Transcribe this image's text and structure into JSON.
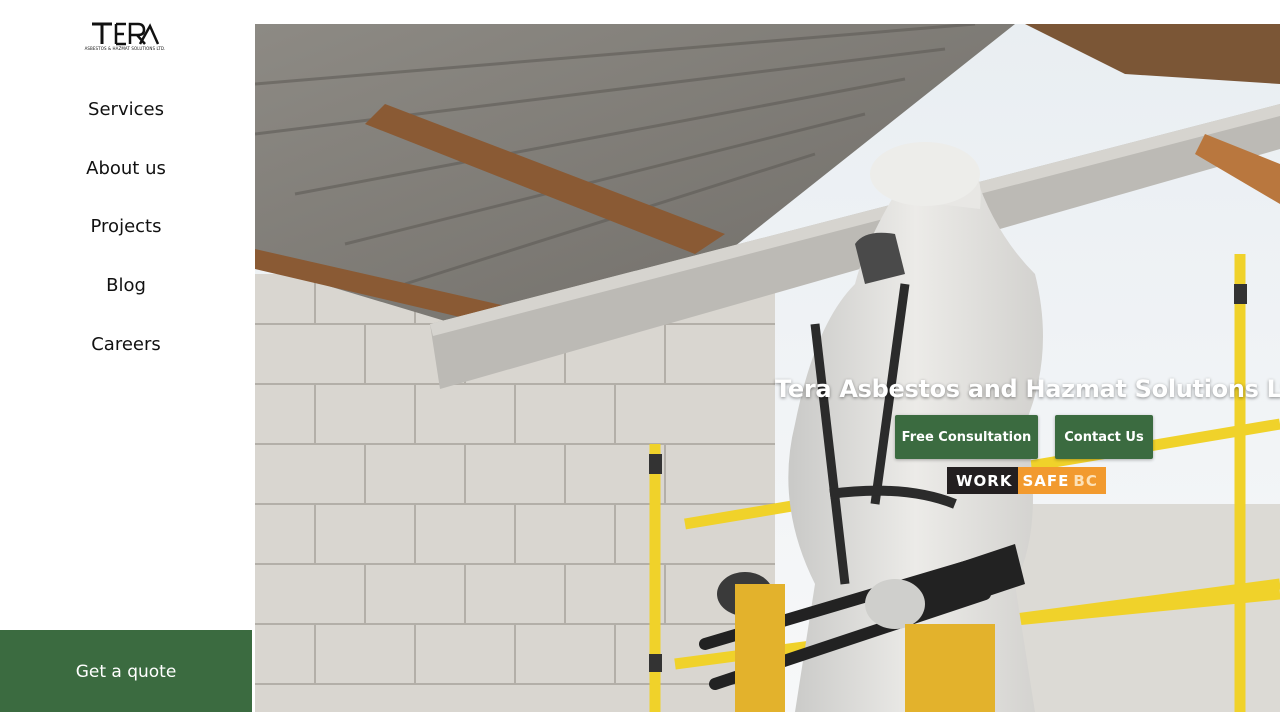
{
  "brand": {
    "logo_mark": "TERA",
    "logo_text": "ASBESTOS & HAZMAT SOLUTIONS LTD."
  },
  "nav": {
    "items": [
      {
        "label": "Services"
      },
      {
        "label": "About us"
      },
      {
        "label": "Projects"
      },
      {
        "label": "Blog"
      },
      {
        "label": "Careers"
      }
    ]
  },
  "cta": {
    "quote_label": "Get a quote"
  },
  "hero": {
    "title": "Tera Asbestos and Hazmat Solutions Ltd.",
    "consult_label": "Free Consultation",
    "contact_label": "Contact Us",
    "badge": {
      "part1": "WORK",
      "part2": "SAFE",
      "part3": "BC"
    }
  },
  "colors": {
    "accent_green": "#3b6b40",
    "worksafe_dark": "#231f20",
    "worksafe_orange": "#f29a2e"
  }
}
